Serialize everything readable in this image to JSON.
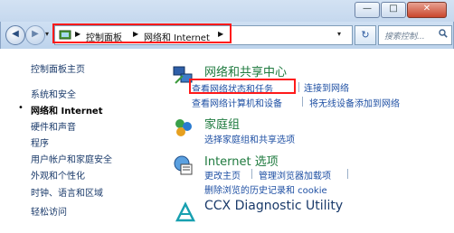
{
  "window": {
    "minimize_glyph": "—",
    "maximize_glyph": "□",
    "close_glyph": "✕"
  },
  "nav": {
    "back_glyph": "◀",
    "forward_glyph": "▶",
    "dropdown_glyph": "▾",
    "refresh_glyph": "↻",
    "breadcrumb": [
      "控制面板",
      "网络和 Internet"
    ],
    "sep": "▶",
    "search_placeholder": "搜索控制...",
    "search_icon": "magnifier-icon"
  },
  "sidebar": {
    "items": [
      {
        "label": "控制面板主页"
      },
      {
        "label": "系统和安全"
      },
      {
        "label": "网络和 Internet",
        "active": true
      },
      {
        "label": "硬件和声音"
      },
      {
        "label": "程序"
      },
      {
        "label": "用户帐户和家庭安全"
      },
      {
        "label": "外观和个性化"
      },
      {
        "label": "时钟、语言和区域"
      },
      {
        "label": "轻松访问"
      }
    ],
    "bullet": "•"
  },
  "sections": {
    "network": {
      "title": "网络和共享中心",
      "icon": "network-sharing-icon",
      "links": [
        "查看网络状态和任务",
        "连接到网络",
        "查看网络计算机和设备",
        "将无线设备添加到网络"
      ]
    },
    "homegroup": {
      "title": "家庭组",
      "icon": "homegroup-icon",
      "links": [
        "选择家庭组和共享选项"
      ]
    },
    "internet": {
      "title": "Internet 选项",
      "icon": "internet-options-icon",
      "links": [
        "更改主页",
        "管理浏览器加载项",
        "删除浏览的历史记录和 cookie"
      ]
    },
    "ccx": {
      "title": "CCX Diagnostic Utility",
      "icon": "ccx-icon"
    }
  },
  "colors": {
    "accent_red": "#ff1a1a",
    "link": "#1e4fa3",
    "category_title": "#1e7a3e"
  }
}
